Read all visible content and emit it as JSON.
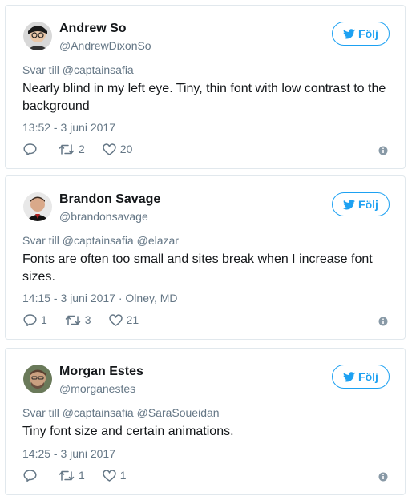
{
  "colors": {
    "accent": "#1da1f2",
    "secondary": "#657786",
    "border": "#e1e8ed"
  },
  "tweets": [
    {
      "name": "Andrew So",
      "handle": "@AndrewDixonSo",
      "follow_label": "Följ",
      "reply_to": "Svar till @captainsafia",
      "text": "Nearly blind in my left eye. Tiny, thin font with low contrast to the background",
      "timestamp": "13:52 - 3 juni 2017",
      "replies": "",
      "retweets": "2",
      "likes": "20"
    },
    {
      "name": "Brandon Savage",
      "handle": "@brandonsavage",
      "follow_label": "Följ",
      "reply_to": "Svar till @captainsafia @elazar",
      "text": "Fonts are often too small and sites break when I increase font sizes.",
      "timestamp": "14:15 - 3 juni 2017 · Olney, MD",
      "replies": "1",
      "retweets": "3",
      "likes": "21"
    },
    {
      "name": "Morgan Estes",
      "handle": "@morganestes",
      "follow_label": "Följ",
      "reply_to": "Svar till @captainsafia @SaraSoueidan",
      "text": "Tiny font size and certain animations.",
      "timestamp": "14:25 - 3 juni 2017",
      "replies": "",
      "retweets": "1",
      "likes": "1"
    }
  ]
}
